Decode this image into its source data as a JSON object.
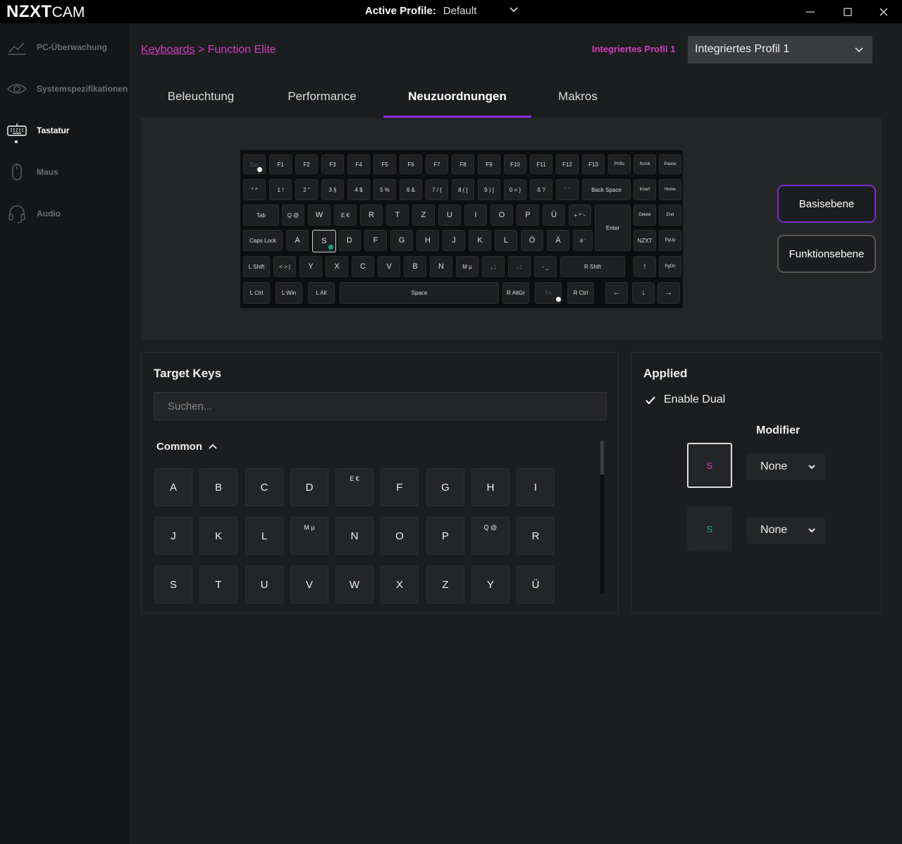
{
  "app": {
    "brand_bold": "NZXT",
    "brand_light": "CAM"
  },
  "titlebar": {
    "active_profile_label": "Active Profile:",
    "active_profile_value": "Default"
  },
  "sidebar": {
    "items": [
      {
        "label": "PC-Überwachung",
        "icon": "chart-line-icon"
      },
      {
        "label": "Systemspezifikationen",
        "icon": "eye-icon"
      },
      {
        "label": "Tastatur",
        "icon": "keyboard-icon"
      },
      {
        "label": "Maus",
        "icon": "mouse-icon"
      },
      {
        "label": "Audio",
        "icon": "headset-icon"
      }
    ]
  },
  "breadcrumb": {
    "parent": "Keyboards",
    "separator": ">",
    "current": "Function Elite"
  },
  "profile": {
    "label": "Integriertes Profil 1",
    "selected": "Integriertes Profil 1"
  },
  "tabs": [
    "Beleuchtung",
    "Performance",
    "Neuzuordnungen",
    "Makros"
  ],
  "keyboard": {
    "row1": [
      "Esc",
      "F1",
      "F2",
      "F3",
      "F4",
      "F5",
      "F6",
      "F7",
      "F8",
      "F9",
      "F10",
      "F11",
      "F12",
      "F13",
      "PrtSc",
      "Scroll",
      "Pause"
    ],
    "row2": [
      "° ^",
      "1 !",
      "2 \"",
      "3 §",
      "4 $",
      "5 %",
      "6 &",
      "7 / {",
      "8 ( [",
      "9 ) ]",
      "0 = }",
      "ß ?",
      "´ `",
      "Back Space",
      "Insert",
      "Home"
    ],
    "row3": [
      "Tab",
      "Q @",
      "W",
      "E €",
      "R",
      "T",
      "Z",
      "U",
      "I",
      "O",
      "P",
      "Ü",
      "+ * ~",
      "Enter",
      "Delete",
      "End"
    ],
    "row4": [
      "Caps Lock",
      "A",
      "S",
      "D",
      "F",
      "G",
      "H",
      "J",
      "K",
      "L",
      "Ö",
      "Ä",
      "# '",
      "NZXT",
      "PgUp"
    ],
    "row5": [
      "L Shift",
      "< > |",
      "Y",
      "X",
      "C",
      "V",
      "B",
      "N",
      "M µ",
      ", ;",
      ". :",
      "- _",
      "R Shift",
      "↑",
      "PgDn"
    ],
    "row6": [
      "L Ctrl",
      "L Win",
      "L Alt",
      "Space",
      "R AltGr",
      "Fn",
      "R Ctrl",
      "←",
      "↓",
      "→"
    ]
  },
  "layers": {
    "base": "Basisebene",
    "function": "Funktionsebene"
  },
  "target_keys": {
    "title": "Target Keys",
    "search_placeholder": "Suchen...",
    "group": "Common",
    "keys": [
      "A",
      "B",
      "C",
      "D",
      "E €",
      "F",
      "G",
      "H",
      "I",
      "J",
      "K",
      "L",
      "M µ",
      "N",
      "O",
      "P",
      "Q @",
      "R",
      "S",
      "T",
      "U",
      "V",
      "W",
      "X",
      "Z",
      "Y",
      "Ü"
    ]
  },
  "applied": {
    "title": "Applied",
    "enable_dual": "Enable Dual",
    "modifier_label": "Modifier",
    "rows": [
      {
        "key": "S",
        "color": "#d33ec0",
        "modifier": "None"
      },
      {
        "key": "S",
        "color": "#1aa39a",
        "modifier": "None"
      }
    ]
  },
  "colors": {
    "accent": "#d33ec0",
    "tab_underline": "#8a2be2",
    "green_dot": "#1aa37a"
  }
}
